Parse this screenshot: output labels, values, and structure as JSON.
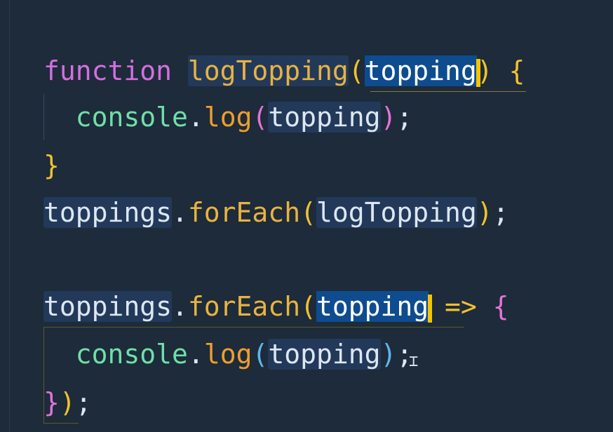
{
  "editor": {
    "lines": {
      "l1": {
        "keyword": "function",
        "fn_name": "logTopping",
        "open_paren": "(",
        "param": "topping",
        "close_paren": ")",
        "open_brace": "{"
      },
      "l2": {
        "object": "console",
        "dot": ".",
        "method": "log",
        "open_paren": "(",
        "arg": "topping",
        "close_paren": ")",
        "semicolon": ";"
      },
      "l3": {
        "close_brace": "}"
      },
      "l4": {
        "object": "toppings",
        "dot": ".",
        "method": "forEach",
        "open_paren": "(",
        "arg": "logTopping",
        "close_paren": ")",
        "semicolon": ";"
      },
      "l6": {
        "object": "toppings",
        "dot": ".",
        "method": "forEach",
        "open_paren": "(",
        "param": "topping",
        "arrow": "=>",
        "open_brace": "{"
      },
      "l7": {
        "object": "console",
        "dot": ".",
        "method": "log",
        "open_paren": "(",
        "arg": "topping",
        "close_paren": ")",
        "semicolon": ";"
      },
      "l8": {
        "close_brace": "}",
        "close_paren": ")",
        "semicolon": ";"
      }
    },
    "colors": {
      "background": "#1d2b3a",
      "keyword": "#d36fe0",
      "function": "#e9b340",
      "selection": "#0e4c8f",
      "cursor": "#f4c400"
    },
    "icons": {
      "text_cursor": "i-beam-cursor-icon"
    }
  }
}
